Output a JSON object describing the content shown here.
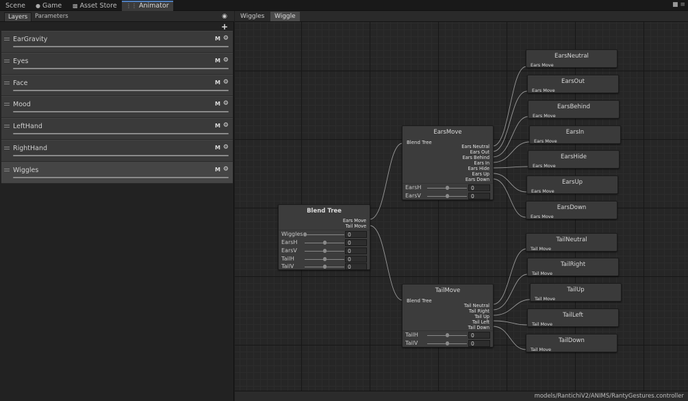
{
  "window_tabs": [
    {
      "label": "Scene",
      "icon": "",
      "active": false
    },
    {
      "label": "Game",
      "icon": "pacman-icon",
      "active": false
    },
    {
      "label": "Asset Store",
      "icon": "bag-icon",
      "active": false
    },
    {
      "label": "Animator",
      "icon": "animator-icon",
      "active": true
    }
  ],
  "left_panel": {
    "tabs": [
      {
        "label": "Layers",
        "active": true
      },
      {
        "label": "Parameters",
        "active": false
      }
    ],
    "layers": [
      {
        "name": "EarGravity",
        "m": "M",
        "selected": false
      },
      {
        "name": "Eyes",
        "m": "M",
        "selected": false
      },
      {
        "name": "Face",
        "m": "M",
        "selected": false
      },
      {
        "name": "Mood",
        "m": "M",
        "selected": false
      },
      {
        "name": "LeftHand",
        "m": "M",
        "selected": false
      },
      {
        "name": "RightHand",
        "m": "M",
        "selected": false
      },
      {
        "name": "Wiggles",
        "m": "M",
        "selected": true
      }
    ]
  },
  "breadcrumb": [
    "Wiggles",
    "Wiggle"
  ],
  "blend_tree": {
    "title": "Blend Tree",
    "outputs": [
      "Ears Move",
      "Tail Move"
    ],
    "params": [
      {
        "name": "Wiggles",
        "value": "0",
        "fraction": 0.0
      },
      {
        "name": "EarsH",
        "value": "0",
        "fraction": 0.5
      },
      {
        "name": "EarsV",
        "value": "0",
        "fraction": 0.5
      },
      {
        "name": "TailH",
        "value": "0",
        "fraction": 0.5
      },
      {
        "name": "TailV",
        "value": "0",
        "fraction": 0.5
      }
    ]
  },
  "ears_move": {
    "title": "EarsMove",
    "sub": "Blend Tree",
    "outputs": [
      "Ears Neutral",
      "Ears Out",
      "Ears Behind",
      "Ears In",
      "Ears Hide",
      "Ears Up",
      "Ears Down"
    ],
    "params": [
      {
        "name": "EarsH",
        "value": "0",
        "fraction": 0.5
      },
      {
        "name": "EarsV",
        "value": "0",
        "fraction": 0.5
      }
    ]
  },
  "tail_move": {
    "title": "TailMove",
    "sub": "Blend Tree",
    "outputs": [
      "Tail Neutral",
      "Tail Right",
      "Tail Up",
      "Tail Left",
      "Tail Down"
    ],
    "params": [
      {
        "name": "TailH",
        "value": "0",
        "fraction": 0.5
      },
      {
        "name": "TailV",
        "value": "0",
        "fraction": 0.5
      }
    ]
  },
  "ears_motions": [
    {
      "title": "EarsNeutral",
      "sub": "Ears Move"
    },
    {
      "title": "EarsOut",
      "sub": "Ears Move"
    },
    {
      "title": "EarsBehind",
      "sub": "Ears Move"
    },
    {
      "title": "EarsIn",
      "sub": "Ears Move"
    },
    {
      "title": "EarsHide",
      "sub": "Ears Move"
    },
    {
      "title": "EarsUp",
      "sub": "Ears Move"
    },
    {
      "title": "EarsDown",
      "sub": "Ears Move"
    }
  ],
  "tail_motions": [
    {
      "title": "TailNeutral",
      "sub": "Tail Move"
    },
    {
      "title": "TailRight",
      "sub": "Tail Move"
    },
    {
      "title": "TailUp",
      "sub": "Tail Move"
    },
    {
      "title": "TailLeft",
      "sub": "Tail Move"
    },
    {
      "title": "TailDown",
      "sub": "Tail Move"
    }
  ],
  "status_path": "models/RantichiV2/ANIMS/RantyGestures.controller"
}
